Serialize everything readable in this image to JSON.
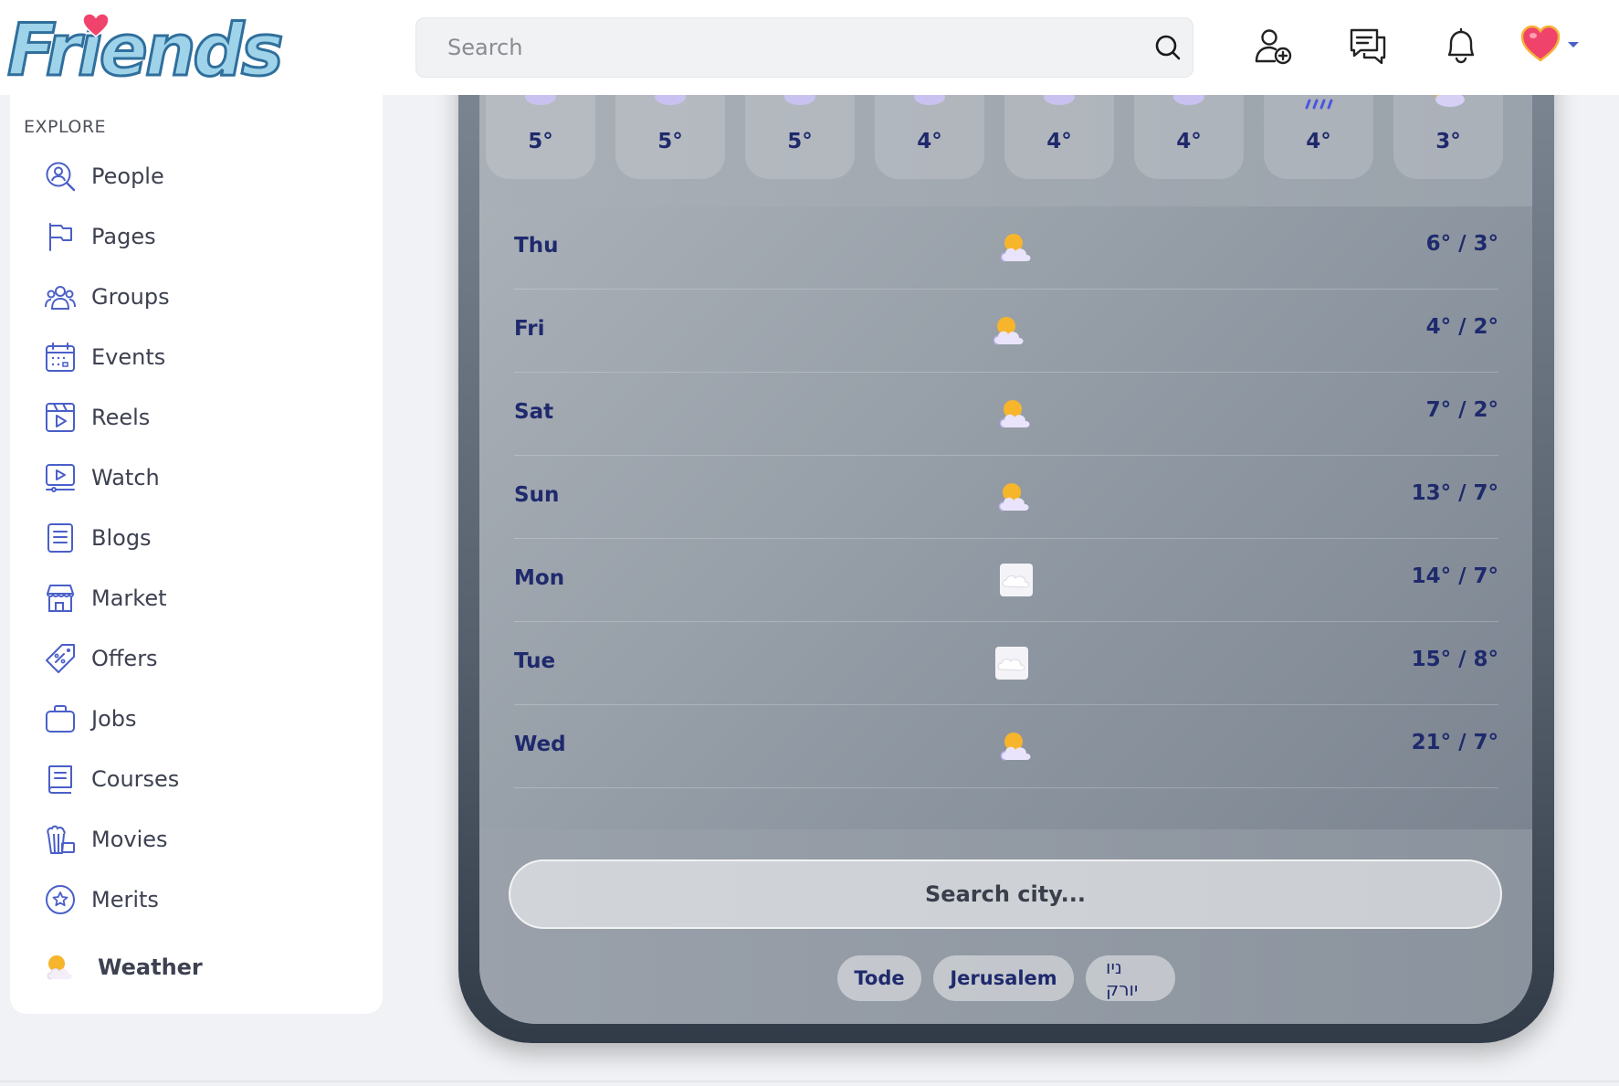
{
  "header": {
    "logo_text": "Friends",
    "search_placeholder": "Search",
    "icons": [
      "add-friend-icon",
      "messages-icon",
      "bell-icon",
      "avatar-heart"
    ],
    "colors": {
      "accent": "#4a5fc8",
      "heart": "#f0436b"
    }
  },
  "sidebar": {
    "section_label": "EXPLORE",
    "items": [
      {
        "label": "People",
        "icon": "people-search-icon"
      },
      {
        "label": "Pages",
        "icon": "flag-icon"
      },
      {
        "label": "Groups",
        "icon": "groups-icon"
      },
      {
        "label": "Events",
        "icon": "calendar-icon"
      },
      {
        "label": "Reels",
        "icon": "reels-icon"
      },
      {
        "label": "Watch",
        "icon": "watch-icon"
      },
      {
        "label": "Blogs",
        "icon": "blog-icon"
      },
      {
        "label": "Market",
        "icon": "store-icon"
      },
      {
        "label": "Offers",
        "icon": "tag-icon"
      },
      {
        "label": "Jobs",
        "icon": "briefcase-icon"
      },
      {
        "label": "Courses",
        "icon": "book-icon"
      },
      {
        "label": "Movies",
        "icon": "popcorn-icon"
      },
      {
        "label": "Merits",
        "icon": "badge-icon"
      },
      {
        "label": "Weather",
        "icon": "weather-icon"
      }
    ]
  },
  "weather": {
    "hourly": [
      {
        "temp": "5°",
        "icon": "cloud-icon"
      },
      {
        "temp": "5°",
        "icon": "cloud-icon"
      },
      {
        "temp": "5°",
        "icon": "cloud-icon"
      },
      {
        "temp": "4°",
        "icon": "cloud-icon"
      },
      {
        "temp": "4°",
        "icon": "cloud-icon"
      },
      {
        "temp": "4°",
        "icon": "cloud-icon"
      },
      {
        "temp": "4°",
        "icon": "rain-icon"
      },
      {
        "temp": "3°",
        "icon": "partly-cloudy-icon"
      }
    ],
    "daily": [
      {
        "day": "Thu",
        "range": "6° / 3°",
        "icon": "partly-cloudy-icon"
      },
      {
        "day": "Fri",
        "range": "4° / 2°",
        "icon": "partly-cloudy-icon"
      },
      {
        "day": "Sat",
        "range": "7° / 2°",
        "icon": "partly-cloudy-icon"
      },
      {
        "day": "Sun",
        "range": "13° / 7°",
        "icon": "partly-cloudy-icon"
      },
      {
        "day": "Mon",
        "range": "14° / 7°",
        "icon": "snow-cloud-icon"
      },
      {
        "day": "Tue",
        "range": "15° / 8°",
        "icon": "snow-cloud-icon"
      },
      {
        "day": "Wed",
        "range": "21° / 7°",
        "icon": "partly-cloudy-icon"
      }
    ],
    "city_search_placeholder": "Search city...",
    "cities": [
      "Tode",
      "Jerusalem",
      "ניו יורק"
    ]
  }
}
